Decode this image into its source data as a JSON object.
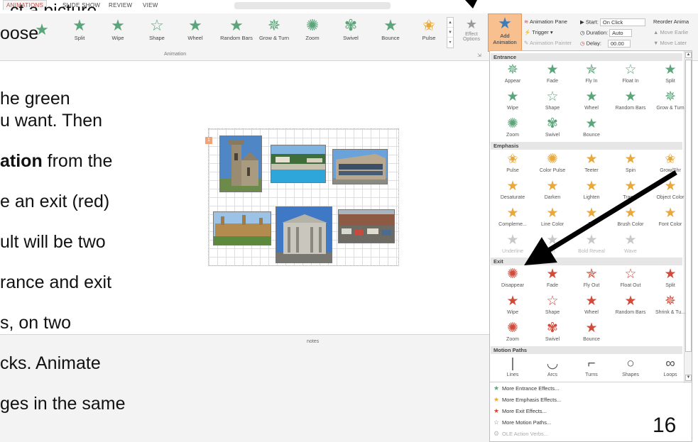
{
  "colors": {
    "entrance": "#5aa67a",
    "emphasis": "#e8a83a",
    "exit": "#d24a3a",
    "ribbon_tab_active": "#c0504d",
    "add_animation_bg": "#f7c08e",
    "arrow": "#000000"
  },
  "tabs": [
    "ANIMATIONS",
    "SLIDE SHOW",
    "REVIEW",
    "VIEW"
  ],
  "ribbon": {
    "animations": [
      "Split",
      "Wipe",
      "Shape",
      "Wheel",
      "Random Bars",
      "Grow & Turn",
      "Zoom",
      "Swivel",
      "Bounce",
      "Pulse"
    ],
    "group_label": "Animation",
    "effect_options": [
      "Effect",
      "Options"
    ],
    "add_animation": [
      "Add",
      "Animation"
    ],
    "animation_pane": "Animation Pane",
    "trigger": "Trigger",
    "animation_painter": "Animation Painter",
    "start_label": "Start:",
    "start_value": "On Click",
    "duration_label": "Duration:",
    "duration_value": "Auto",
    "delay_label": "Delay:",
    "delay_value": "00.00",
    "reorder": "Reorder Anima",
    "move_earlier": "Move Earlie",
    "move_later": "Move Later"
  },
  "slide_text": {
    "line1_partial": "ct a picture",
    "line2": "oose",
    "line3": "he green",
    "line4": "u want.  Then",
    "line5_bold": "ation",
    "line5_rest": " from the",
    "line6": "e an exit (red)",
    "line7": "ult will be two",
    "line8": "rance and exit",
    "line9": "s, on two",
    "line10": "cks.  Animate",
    "line11": "ges in the same"
  },
  "notes_label": "notes",
  "gallery": {
    "entrance_header": "Entrance",
    "entrance": [
      "Appear",
      "Fade",
      "Fly In",
      "Float In",
      "Split",
      "Wipe",
      "Shape",
      "Wheel",
      "Random Bars",
      "Grow & Turn",
      "Zoom",
      "Swivel",
      "Bounce"
    ],
    "emphasis_header": "Emphasis",
    "emphasis": [
      "Pulse",
      "Color Pulse",
      "Teeter",
      "Spin",
      "Grow/Shr",
      "Desaturate",
      "Darken",
      "Lighten",
      "Transp",
      "Object Color",
      "Compleme...",
      "Line Color",
      "Fill",
      "Brush Color",
      "Font Color",
      "Underline",
      "sh",
      "Bold Reveal",
      "Wave"
    ],
    "exit_header": "Exit",
    "exit": [
      "Disappear",
      "Fade",
      "Fly Out",
      "Float Out",
      "Split",
      "Wipe",
      "Shape",
      "Wheel",
      "Random Bars",
      "Shrink & Tu...",
      "Zoom",
      "Swivel",
      "Bounce"
    ],
    "motion_header": "Motion Paths",
    "motion": [
      "Lines",
      "Arcs",
      "Turns",
      "Shapes",
      "Loops"
    ],
    "more": [
      "More Entrance Effects...",
      "More Emphasis Effects...",
      "More Exit Effects...",
      "More Motion Paths...",
      "OLE Action Verbs..."
    ]
  },
  "slide_number": "16"
}
